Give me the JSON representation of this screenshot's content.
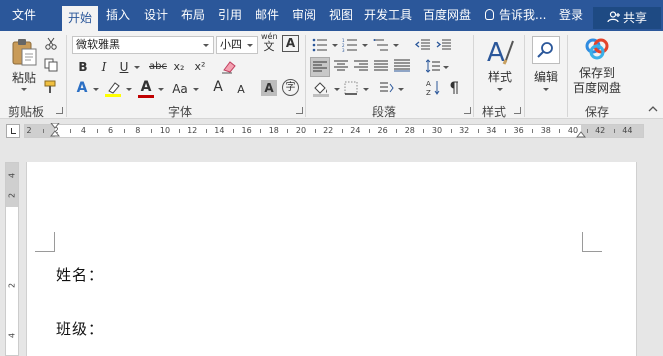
{
  "menu": {
    "tabs": [
      {
        "label": "文件",
        "active": false
      },
      {
        "label": "开始",
        "active": true
      },
      {
        "label": "插入",
        "active": false
      },
      {
        "label": "设计",
        "active": false
      },
      {
        "label": "布局",
        "active": false
      },
      {
        "label": "引用",
        "active": false
      },
      {
        "label": "邮件",
        "active": false
      },
      {
        "label": "审阅",
        "active": false
      },
      {
        "label": "视图",
        "active": false
      },
      {
        "label": "开发工具",
        "active": false
      },
      {
        "label": "百度网盘",
        "active": false
      }
    ],
    "tell_me": "告诉我...",
    "login": "登录",
    "share": "共享"
  },
  "ribbon": {
    "clipboard": {
      "label": "剪贴板",
      "paste": "粘贴"
    },
    "font": {
      "label": "字体",
      "font_name": "微软雅黑",
      "font_size": "小四",
      "pinyin_glyph": "wén",
      "bold": "B",
      "italic": "I",
      "underline": "U",
      "strike": "abc",
      "subscript": "x₂",
      "superscript": "x²",
      "case": "Aa",
      "grow": "A",
      "shrink": "A",
      "char_shading": "A",
      "enclose": "字"
    },
    "paragraph": {
      "label": "段落"
    },
    "styles": {
      "label": "样式",
      "button": "样式"
    },
    "editing": {
      "button": "编辑"
    },
    "save": {
      "label": "保存",
      "button_line1": "保存到",
      "button_line2": "百度网盘"
    }
  },
  "ruler": {
    "horizontal": [
      "2",
      "2",
      "4",
      "6",
      "8",
      "10",
      "12",
      "14",
      "16",
      "18",
      "20",
      "22",
      "24",
      "26",
      "28",
      "30",
      "32",
      "34",
      "36",
      "38",
      "40",
      "42",
      "44"
    ],
    "vertical": [
      "4",
      "2",
      "2",
      "4"
    ]
  },
  "document": {
    "lines": [
      "姓名：",
      "班级："
    ]
  },
  "colors": {
    "brand": "#2b579a",
    "highlight": "#ffff00",
    "font_color": "#c00000"
  }
}
